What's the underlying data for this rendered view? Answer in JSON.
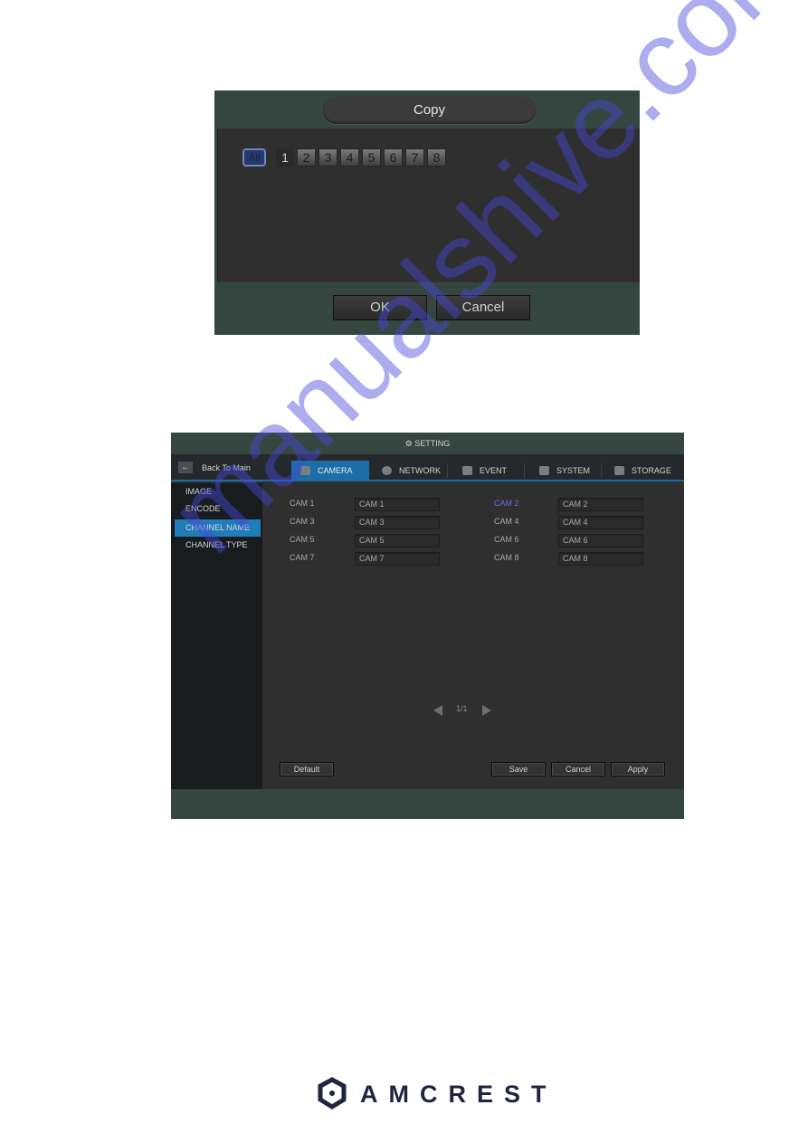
{
  "copy_dialog": {
    "title": "Copy",
    "all_label": "All",
    "channels": [
      "1",
      "2",
      "3",
      "4",
      "5",
      "6",
      "7",
      "8"
    ],
    "ok_label": "OK",
    "cancel_label": "Cancel"
  },
  "setting": {
    "title": "SETTING",
    "back_label": "Back To Main",
    "tabs": [
      {
        "label": "CAMERA",
        "active": true
      },
      {
        "label": "NETWORK"
      },
      {
        "label": "EVENT"
      },
      {
        "label": "SYSTEM"
      },
      {
        "label": "STORAGE"
      }
    ],
    "sidebar": [
      "IMAGE",
      "ENCODE",
      "CHANNEL NAME",
      "CHANNEL TYPE"
    ],
    "active_sidebar": "CHANNEL NAME",
    "channels": [
      {
        "label": "CAM 1",
        "value": "CAM 1"
      },
      {
        "label": "CAM 2",
        "value": "CAM 2"
      },
      {
        "label": "CAM 3",
        "value": "CAM 3"
      },
      {
        "label": "CAM 4",
        "value": "CAM 4"
      },
      {
        "label": "CAM 5",
        "value": "CAM 5"
      },
      {
        "label": "CAM 6",
        "value": "CAM 6"
      },
      {
        "label": "CAM 7",
        "value": "CAM 7"
      },
      {
        "label": "CAM 8",
        "value": "CAM 8"
      }
    ],
    "pagination": "1/1",
    "buttons": {
      "default": "Default",
      "save": "Save",
      "cancel": "Cancel",
      "apply": "Apply"
    }
  },
  "footer": {
    "brand": "AMCREST"
  },
  "watermark": "manualshive.com"
}
